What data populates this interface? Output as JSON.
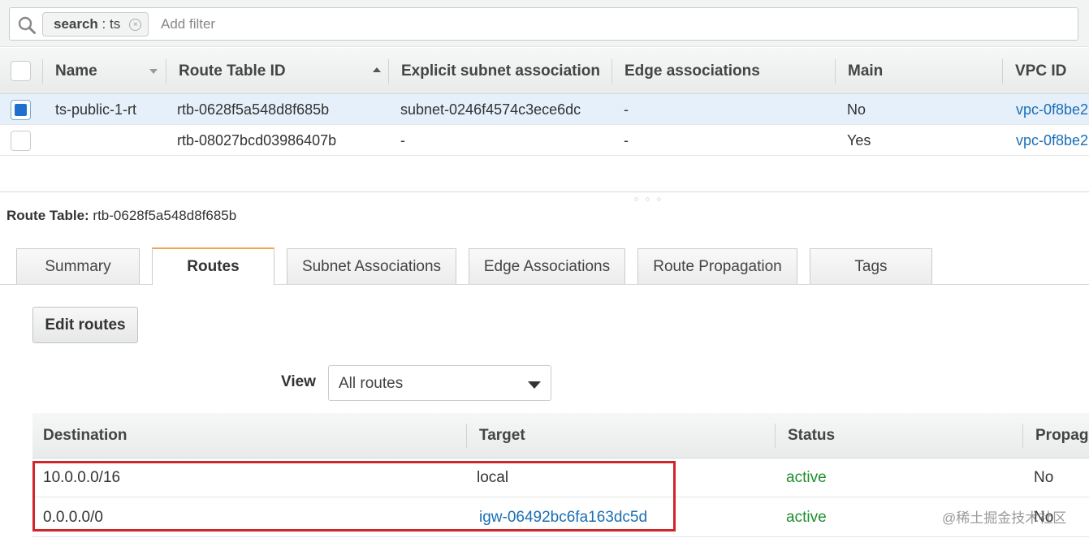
{
  "search": {
    "token_key": "search",
    "token_sep": " : ",
    "token_value": "ts",
    "token_close": "×",
    "placeholder": "Add filter"
  },
  "top_table": {
    "columns": [
      "Name",
      "Route Table ID",
      "Explicit subnet association",
      "Edge associations",
      "Main",
      "VPC ID"
    ],
    "rows": [
      {
        "selected": true,
        "name": "ts-public-1-rt",
        "route_table_id": "rtb-0628f5a548d8f685b",
        "subnet": "subnet-0246f4574c3ece6dc",
        "edge": "-",
        "main": "No",
        "vpc": "vpc-0f8be2"
      },
      {
        "selected": false,
        "name": "",
        "route_table_id": "rtb-08027bcd03986407b",
        "subnet": "-",
        "edge": "-",
        "main": "Yes",
        "vpc": "vpc-0f8be2"
      }
    ]
  },
  "details": {
    "label": "Route Table:",
    "value": "rtb-0628f5a548d8f685b",
    "splitter_grip": "○ ○ ○"
  },
  "tabs": [
    "Summary",
    "Routes",
    "Subnet Associations",
    "Edge Associations",
    "Route Propagation",
    "Tags"
  ],
  "active_tab": "Routes",
  "edit_routes_label": "Edit routes",
  "view": {
    "label": "View",
    "selected": "All routes"
  },
  "routes_table": {
    "columns": [
      "Destination",
      "Target",
      "Status",
      "Propag"
    ],
    "rows": [
      {
        "destination": "10.0.0.0/16",
        "target": "local",
        "target_is_link": false,
        "status": "active",
        "propagated": "No"
      },
      {
        "destination": "0.0.0.0/0",
        "target": "igw-06492bc6fa163dc5d",
        "target_is_link": true,
        "status": "active",
        "propagated": "No"
      }
    ]
  },
  "watermark": "@稀土掘金技术社区",
  "colors": {
    "link": "#1a6eb5",
    "status_active": "#1e8f2d",
    "tab_accent": "#f0a44d",
    "highlight": "#d0252b",
    "selected_row": "#e6f0fa"
  }
}
